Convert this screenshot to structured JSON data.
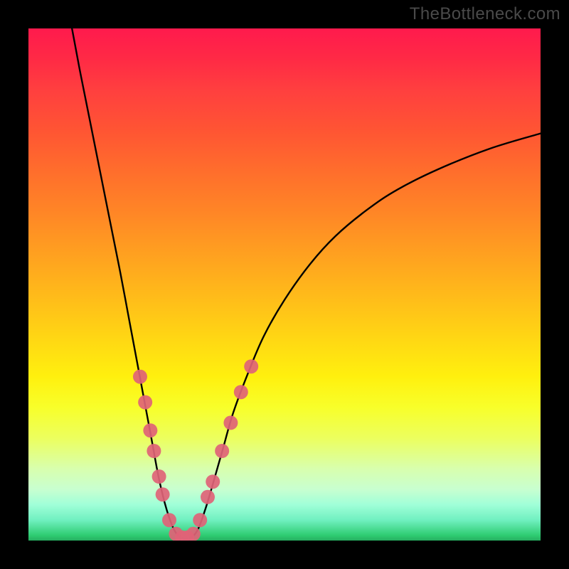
{
  "watermark": {
    "text": "TheBottleneck.com"
  },
  "chart_data": {
    "type": "line",
    "title": "",
    "xlabel": "",
    "ylabel": "",
    "xlim": [
      0,
      100
    ],
    "ylim": [
      0,
      100
    ],
    "curve": {
      "name": "bottleneck-curve",
      "points": [
        {
          "x": 8.5,
          "y": 100
        },
        {
          "x": 10,
          "y": 92
        },
        {
          "x": 12,
          "y": 82
        },
        {
          "x": 14,
          "y": 72
        },
        {
          "x": 16,
          "y": 62
        },
        {
          "x": 18,
          "y": 52
        },
        {
          "x": 19.5,
          "y": 44
        },
        {
          "x": 21,
          "y": 36
        },
        {
          "x": 22.5,
          "y": 28
        },
        {
          "x": 24,
          "y": 20
        },
        {
          "x": 25.5,
          "y": 12
        },
        {
          "x": 27,
          "y": 6
        },
        {
          "x": 28.5,
          "y": 2
        },
        {
          "x": 30,
          "y": 0.5
        },
        {
          "x": 31.5,
          "y": 0.5
        },
        {
          "x": 33,
          "y": 2
        },
        {
          "x": 34.5,
          "y": 6
        },
        {
          "x": 36,
          "y": 11
        },
        {
          "x": 38,
          "y": 18
        },
        {
          "x": 40,
          "y": 25
        },
        {
          "x": 43,
          "y": 33
        },
        {
          "x": 46,
          "y": 40
        },
        {
          "x": 50,
          "y": 47
        },
        {
          "x": 55,
          "y": 54
        },
        {
          "x": 60,
          "y": 59.5
        },
        {
          "x": 66,
          "y": 64.5
        },
        {
          "x": 72,
          "y": 68.5
        },
        {
          "x": 80,
          "y": 72.5
        },
        {
          "x": 90,
          "y": 76.5
        },
        {
          "x": 100,
          "y": 79.5
        }
      ]
    },
    "markers": {
      "name": "highlighted-points",
      "color": "#e06377",
      "radius": 10,
      "points": [
        {
          "x": 21.8,
          "y": 32
        },
        {
          "x": 22.8,
          "y": 27
        },
        {
          "x": 23.8,
          "y": 21.5
        },
        {
          "x": 24.5,
          "y": 17.5
        },
        {
          "x": 25.5,
          "y": 12.5
        },
        {
          "x": 26.2,
          "y": 9
        },
        {
          "x": 27.5,
          "y": 4
        },
        {
          "x": 28.8,
          "y": 1.3
        },
        {
          "x": 30,
          "y": 0.6
        },
        {
          "x": 31,
          "y": 0.6
        },
        {
          "x": 32.2,
          "y": 1.3
        },
        {
          "x": 33.5,
          "y": 4
        },
        {
          "x": 35,
          "y": 8.5
        },
        {
          "x": 36,
          "y": 11.5
        },
        {
          "x": 37.8,
          "y": 17.5
        },
        {
          "x": 39.5,
          "y": 23
        },
        {
          "x": 41.5,
          "y": 29
        },
        {
          "x": 43.5,
          "y": 34
        }
      ]
    }
  }
}
